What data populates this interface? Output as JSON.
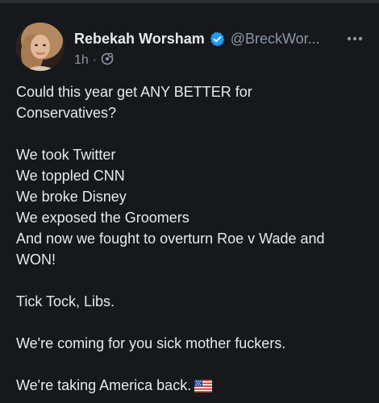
{
  "tweet": {
    "author": {
      "display_name": "Rebekah Worsham",
      "handle": "@BreckWor...",
      "verified": true
    },
    "time": "1h",
    "separator": "·",
    "audience_icon": "community-icon",
    "more_icon": "more-options-icon",
    "lines": [
      "Could this year get ANY BETTER for",
      "Conservatives?",
      "",
      "We took Twitter",
      "We toppled CNN",
      "We broke Disney",
      "We exposed the Groomers",
      "And now we fought to overturn Roe v Wade and",
      "WON!",
      "",
      "Tick Tock, Libs.",
      "",
      "We're coming for you sick mother fuckers.",
      "",
      "We're taking America back."
    ],
    "trailing_emoji": "us-flag-icon"
  },
  "colors": {
    "background": "#16181c",
    "text": "#e7e9ea",
    "secondary_text": "#8b98a5",
    "verified_blue": "#1d9bf0"
  }
}
